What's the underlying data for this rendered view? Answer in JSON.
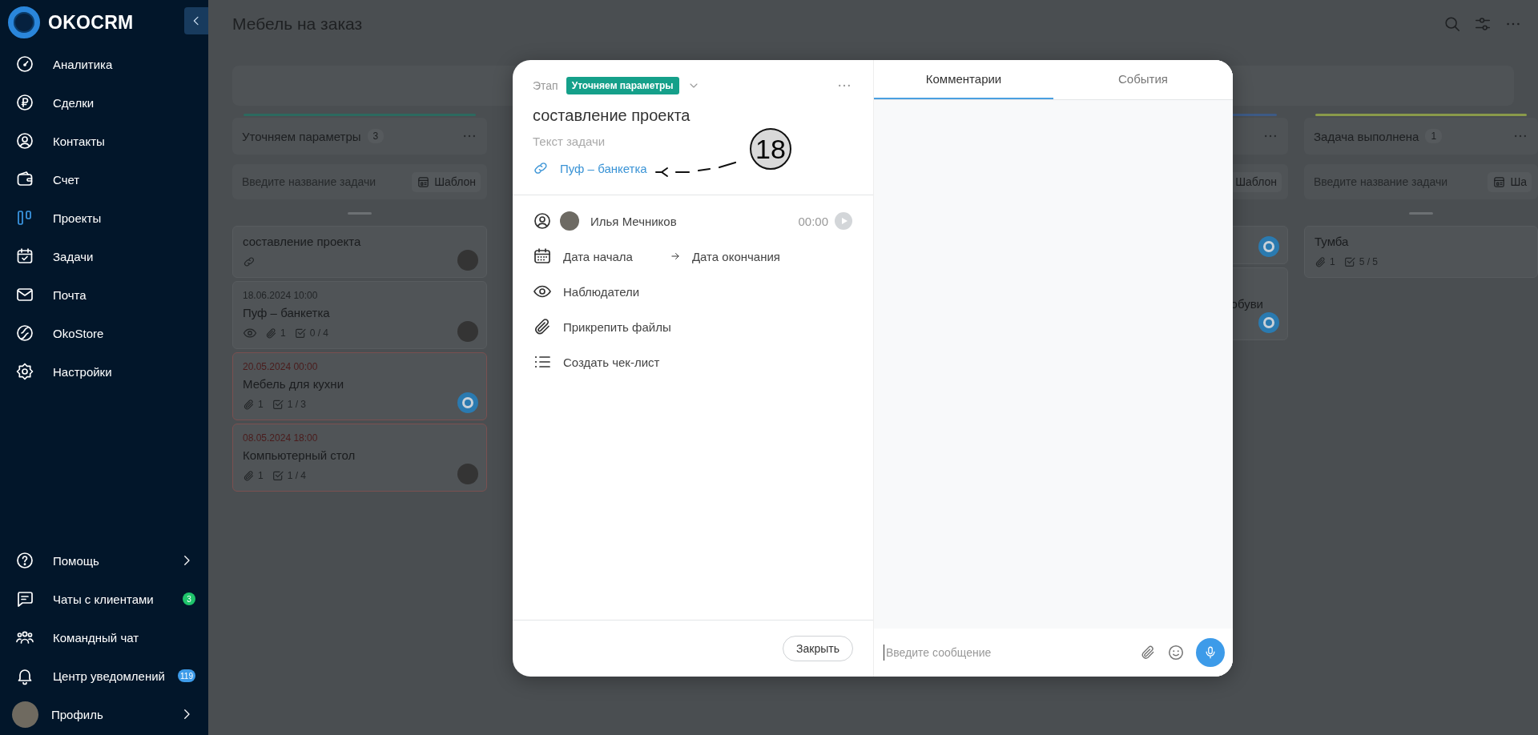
{
  "sidebar": {
    "logo": "OKOCRM",
    "items": [
      {
        "label": "Аналитика",
        "selected": false
      },
      {
        "label": "Сделки",
        "selected": false
      },
      {
        "label": "Контакты",
        "selected": false
      },
      {
        "label": "Счет",
        "selected": false
      },
      {
        "label": "Проекты",
        "selected": true
      },
      {
        "label": "Задачи",
        "selected": false
      },
      {
        "label": "Почта",
        "selected": false
      },
      {
        "label": "OkoStore",
        "selected": false
      },
      {
        "label": "Настройки",
        "selected": false
      }
    ],
    "bottom_items": [
      {
        "label": "Помощь",
        "kind": "submenu"
      },
      {
        "label": "Чаты с клиентами",
        "kind": "link",
        "badge": "3",
        "color": "#1fc46b"
      },
      {
        "label": "Командный чат",
        "kind": "link"
      },
      {
        "label": "Центр уведомлений",
        "kind": "link",
        "badge": "119",
        "color": "#3d9be9"
      },
      {
        "label": "Профиль",
        "kind": "submenu"
      }
    ]
  },
  "board": {
    "title": "Мебель на заказ",
    "columns": [
      {
        "kind": "full",
        "title": "Уточняем параметры",
        "count": "3",
        "color": "#2c6a5f",
        "placeholder": "Введите название задачи",
        "template_label": "Шаблон",
        "cards": [
          {
            "kind": "photo",
            "title": "составление проекта",
            "overdue": false,
            "link": true,
            "watchers": false
          },
          {
            "date": "18.06.2024 10:00",
            "title": "Пуф – банкетка",
            "overdue": false,
            "link": false,
            "watchers": true,
            "attachments": "1",
            "checklist": "0 / 4",
            "kind": "photo"
          },
          {
            "date": "20.05.2024 00:00",
            "title": "Мебель для кухни",
            "overdue": true,
            "link": false,
            "watchers": false,
            "attachments": "1",
            "checklist": "1 / 3",
            "kind": "app"
          },
          {
            "date": "08.05.2024 18:00",
            "title": "Компьютерный стол",
            "overdue": true,
            "link": false,
            "watchers": false,
            "attachments": "1",
            "checklist": "1 / 4",
            "kind": "photo"
          }
        ]
      },
      {
        "kind": "partial",
        "color": "#3d5a85",
        "template_label": "Шаблон",
        "cards": [
          {
            "overdue": false,
            "kind": "app"
          },
          {
            "title": "обуви",
            "overdue": false,
            "kind": "app"
          }
        ]
      },
      {
        "kind": "full",
        "title": "Задача выполнена",
        "count": "1",
        "color": "#8a9a4a",
        "placeholder": "Введите название задачи",
        "template_label": "Ша",
        "cards": [
          {
            "title": "Тумба",
            "overdue": false,
            "link": false,
            "watchers": false,
            "attachments": "1",
            "checklist": "5 / 5",
            "kind": "plain"
          }
        ]
      }
    ]
  },
  "task": {
    "stage_label": "Этап",
    "stage": "Уточняем параметры",
    "title": "составление проекта",
    "description_placeholder": "Текст задачи",
    "linked_task": "Пуф – банкетка",
    "callout": "18",
    "assignee": "Илья Мечников",
    "timer": "00:00",
    "start_date": "Дата начала",
    "end_date": "Дата окончания",
    "actions": [
      "Наблюдатели",
      "Прикрепить файлы",
      "Создать чек-лист"
    ],
    "close_label": "Закрыть",
    "tabs": [
      {
        "label": "Комментарии",
        "selected": true
      },
      {
        "label": "События",
        "selected": false
      }
    ],
    "message_placeholder": "Введите сообщение"
  }
}
